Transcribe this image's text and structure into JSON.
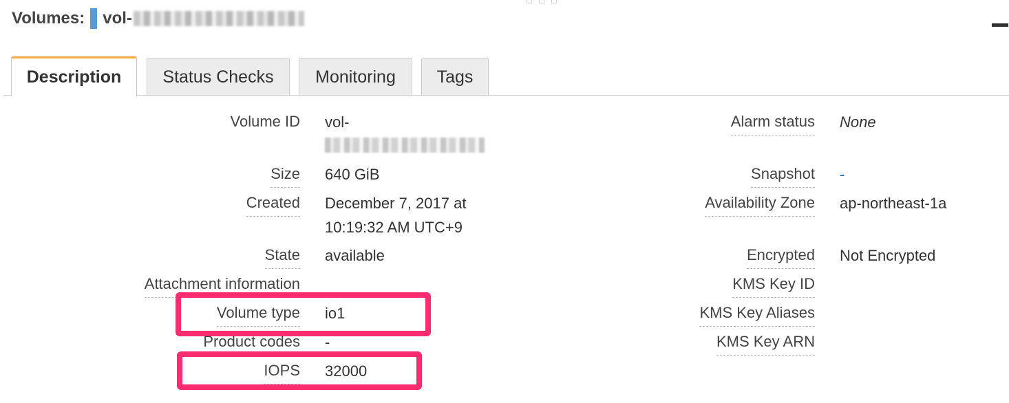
{
  "header": {
    "title": "Volumes:",
    "volume_prefix": "vol-"
  },
  "tabs": [
    {
      "label": "Description",
      "active": true
    },
    {
      "label": "Status Checks",
      "active": false
    },
    {
      "label": "Monitoring",
      "active": false
    },
    {
      "label": "Tags",
      "active": false
    }
  ],
  "details_left": {
    "volume_id": {
      "label": "Volume ID",
      "value": "vol-"
    },
    "size": {
      "label": "Size",
      "value": "640 GiB"
    },
    "created": {
      "label": "Created",
      "value_line1": "December 7, 2017 at",
      "value_line2": "10:19:32 AM UTC+9"
    },
    "state": {
      "label": "State",
      "value": "available"
    },
    "attachment": {
      "label": "Attachment information",
      "value": ""
    },
    "volume_type": {
      "label": "Volume type",
      "value": "io1"
    },
    "product_codes": {
      "label": "Product codes",
      "value": "-"
    },
    "iops": {
      "label": "IOPS",
      "value": "32000"
    }
  },
  "details_right": {
    "alarm_status": {
      "label": "Alarm status",
      "value": "None"
    },
    "snapshot": {
      "label": "Snapshot",
      "value": "-"
    },
    "availability_zone": {
      "label": "Availability Zone",
      "value": "ap-northeast-1a"
    },
    "encrypted": {
      "label": "Encrypted",
      "value": "Not Encrypted"
    },
    "kms_key_id": {
      "label": "KMS Key ID",
      "value": ""
    },
    "kms_key_aliases": {
      "label": "KMS Key Aliases",
      "value": ""
    },
    "kms_key_arn": {
      "label": "KMS Key ARN",
      "value": ""
    }
  },
  "colors": {
    "active_tab_accent": "#f4a93e",
    "highlight_box": "#ff2d6f",
    "volume_tag": "#5b9bd5",
    "link": "#1166bb"
  },
  "icons": {
    "maximize": "maximize-icon",
    "resize_grip": "resize-grip-icon"
  }
}
